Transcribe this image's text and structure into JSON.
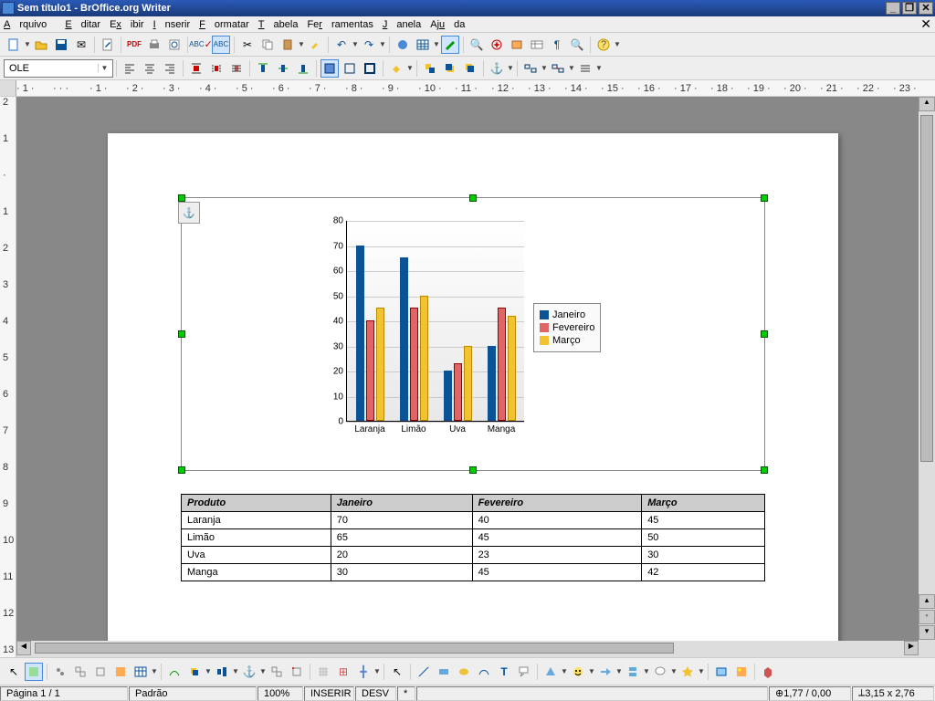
{
  "window": {
    "title": "Sem título1 - BrOffice.org Writer"
  },
  "menu": {
    "items": [
      "Arquivo",
      "Editar",
      "Exibir",
      "Inserir",
      "Formatar",
      "Tabela",
      "Ferramentas",
      "Janela",
      "Ajuda"
    ]
  },
  "combo": {
    "style": "OLE"
  },
  "chart_data": {
    "type": "bar",
    "categories": [
      "Laranja",
      "Limão",
      "Uva",
      "Manga"
    ],
    "series": [
      {
        "name": "Janeiro",
        "values": [
          70,
          65,
          20,
          30
        ]
      },
      {
        "name": "Fevereiro",
        "values": [
          40,
          45,
          23,
          45
        ]
      },
      {
        "name": "Março",
        "values": [
          45,
          50,
          30,
          42
        ]
      }
    ],
    "ylim": [
      0,
      80
    ],
    "ytick": 10,
    "colors": {
      "Janeiro": "#0b5394",
      "Fevereiro": "#e06666",
      "Março": "#f1c232"
    }
  },
  "table": {
    "headers": [
      "Produto",
      "Janeiro",
      "Fevereiro",
      "Março"
    ],
    "rows": [
      [
        "Laranja",
        "70",
        "40",
        "45"
      ],
      [
        "Limão",
        "65",
        "45",
        "50"
      ],
      [
        "Uva",
        "20",
        "23",
        "30"
      ],
      [
        "Manga",
        "30",
        "45",
        "42"
      ]
    ]
  },
  "status": {
    "page": "Página 1 / 1",
    "style": "Padrão",
    "zoom": "100%",
    "insert": "INSERIR",
    "desv": "DESV",
    "star": "*",
    "pos": "1,77 / 0,00",
    "size": "3,15 x 2,76"
  },
  "ruler": {
    "hmarks": [
      "1",
      "",
      "1",
      "2",
      "3",
      "4",
      "5",
      "6",
      "7",
      "8",
      "9",
      "10",
      "11",
      "12",
      "13",
      "14",
      "15",
      "16",
      "17",
      "18",
      "19",
      "20",
      "21",
      "22",
      "23"
    ],
    "vmarks": [
      "2",
      "1",
      "",
      "1",
      "2",
      "3",
      "4",
      "5",
      "6",
      "7",
      "8",
      "9",
      "10",
      "11",
      "12",
      "13"
    ]
  }
}
